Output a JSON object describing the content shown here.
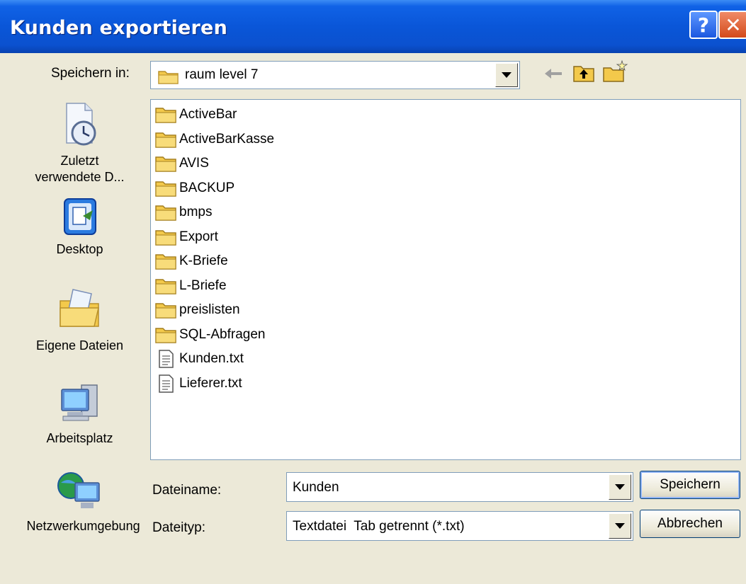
{
  "window": {
    "title": "Kunden exportieren",
    "help_label": "?",
    "close_label": "✕"
  },
  "lookin": {
    "label": "Speichern in:",
    "value": "raum level 7"
  },
  "places": [
    {
      "label": "Zuletzt verwendete D...",
      "icon": "recent-documents-icon"
    },
    {
      "label": "Desktop",
      "icon": "desktop-icon"
    },
    {
      "label": "Eigene Dateien",
      "icon": "my-documents-icon"
    },
    {
      "label": "Arbeitsplatz",
      "icon": "my-computer-icon"
    },
    {
      "label": "Netzwerkumgebung",
      "icon": "network-icon"
    }
  ],
  "files": [
    {
      "name": "ActiveBar",
      "type": "folder"
    },
    {
      "name": "ActiveBarKasse",
      "type": "folder"
    },
    {
      "name": "AVIS",
      "type": "folder"
    },
    {
      "name": "BACKUP",
      "type": "folder"
    },
    {
      "name": "bmps",
      "type": "folder"
    },
    {
      "name": "Export",
      "type": "folder"
    },
    {
      "name": "K-Briefe",
      "type": "folder"
    },
    {
      "name": "L-Briefe",
      "type": "folder"
    },
    {
      "name": "preislisten",
      "type": "folder"
    },
    {
      "name": "SQL-Abfragen",
      "type": "folder"
    },
    {
      "name": "Kunden.txt",
      "type": "text"
    },
    {
      "name": "Lieferer.txt",
      "type": "text"
    }
  ],
  "filename": {
    "label": "Dateiname:",
    "value": "Kunden"
  },
  "filetype": {
    "label": "Dateityp:",
    "value": "Textdatei  Tab getrennt (*.txt)"
  },
  "buttons": {
    "save": "Speichern",
    "cancel": "Abbrechen"
  },
  "colors": {
    "titlebar": "#0a56d8",
    "dialog_bg": "#ece9d8",
    "folder": "#f3c94b"
  }
}
